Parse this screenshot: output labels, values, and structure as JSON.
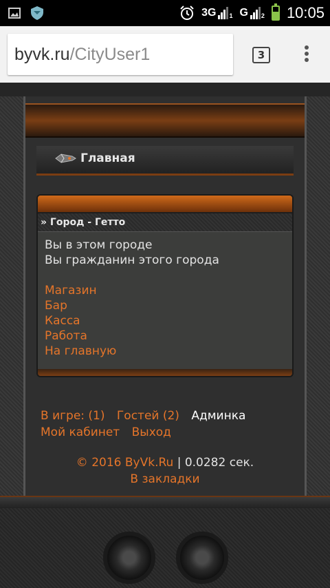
{
  "status_bar": {
    "time": "10:05",
    "network_1": "3G",
    "network_1_sup": "1",
    "network_2": "G",
    "network_2_sup": "2",
    "battery_level": 0.6,
    "icons": [
      "image-icon",
      "shield-icon",
      "alarm-icon",
      "signal-icon",
      "battery-icon"
    ]
  },
  "browser": {
    "url_host": "byvk.ru",
    "url_path": "/CityUser1",
    "tab_count": "3"
  },
  "nav": {
    "title": "Главная"
  },
  "city_block": {
    "heading": "» Город - Гетто",
    "lines": [
      "Вы в этом городе",
      "Вы гражданин этого города"
    ],
    "links": [
      "Магазин",
      "Бар",
      "Касса",
      "Работа",
      "На главную"
    ]
  },
  "footer": {
    "in_game": "В игре: (1)",
    "guests": "Гостей (2)",
    "admin": "Админка",
    "cabinet": "Мой кабинет",
    "logout": "Выход",
    "copyright": "© 2016 ByVk.Ru",
    "timing": " | 0.0282 сек.",
    "bookmarks": "В закладки"
  },
  "colors": {
    "accent_orange": "#e5752a",
    "background": "#2e2e2e"
  }
}
